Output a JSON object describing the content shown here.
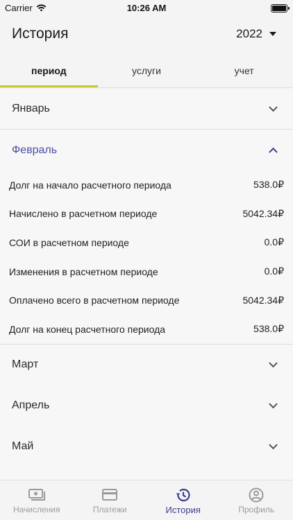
{
  "status_bar": {
    "carrier": "Carrier",
    "time": "10:26 AM"
  },
  "header": {
    "title": "История",
    "year": "2022"
  },
  "tabs": [
    {
      "label": "период",
      "active": true
    },
    {
      "label": "услуги",
      "active": false
    },
    {
      "label": "учет",
      "active": false
    }
  ],
  "months": {
    "january": "Январь",
    "february": "Февраль",
    "march": "Март",
    "april": "Апрель",
    "may": "Май"
  },
  "february_details": [
    {
      "label": "Долг на начало расчетного периода",
      "value": "538.0₽"
    },
    {
      "label": "Начислено в расчетном периоде",
      "value": "5042.34₽"
    },
    {
      "label": "СОИ в расчетном периоде",
      "value": "0.0₽"
    },
    {
      "label": "Изменения в расчетном периоде",
      "value": "0.0₽"
    },
    {
      "label": "Оплачено всего в расчетном периоде",
      "value": "5042.34₽"
    },
    {
      "label": "Долг на конец расчетного периода",
      "value": "538.0₽"
    }
  ],
  "bottom_nav": [
    {
      "label": "Начисления",
      "icon": "money-icon",
      "active": false
    },
    {
      "label": "Платежи",
      "icon": "card-icon",
      "active": false
    },
    {
      "label": "История",
      "icon": "history-icon",
      "active": true
    },
    {
      "label": "Профиль",
      "icon": "profile-icon",
      "active": false
    }
  ],
  "colors": {
    "accent": "#3c3f8c",
    "tab_underline": "#c3cc2a",
    "open_month": "#4c4fa3"
  }
}
